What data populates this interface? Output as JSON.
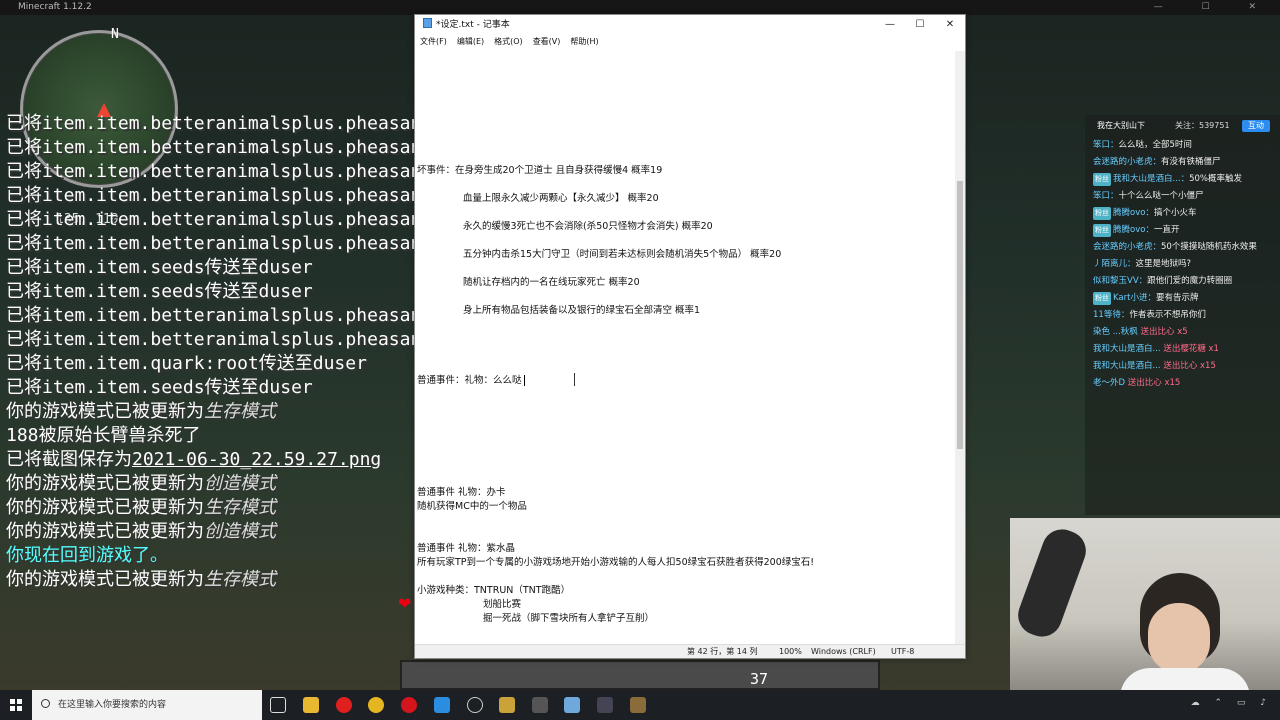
{
  "minecraft": {
    "window_title": "Minecraft 1.12.2",
    "minimap": {
      "compass_n": "N",
      "coords_text": "135, 119"
    },
    "chat_lines": [
      {
        "text": "已将item.item.betteranimalsplus.pheasant_"
      },
      {
        "text": "已将item.item.betteranimalsplus.pheasant_"
      },
      {
        "text": "已将item.item.betteranimalsplus.pheasant_"
      },
      {
        "text": "已将item.item.betteranimalsplus.pheasant_"
      },
      {
        "text": "已将item.item.betteranimalsplus.pheasant_"
      },
      {
        "text": "已将item.item.betteranimalsplus.pheasant_"
      },
      {
        "text": "已将item.item.seeds传送至duser"
      },
      {
        "text": "已将item.item.seeds传送至duser"
      },
      {
        "text": "已将item.item.betteranimalsplus.pheasant_"
      },
      {
        "text": "已将item.item.betteranimalsplus.pheasant_"
      },
      {
        "text": "已将item.item.quark:root传送至duser"
      },
      {
        "text": "已将item.item.seeds传送至duser"
      }
    ],
    "mode_lines": [
      {
        "prefix": "你的游戏模式已被更新为",
        "mode": "生存模式"
      },
      {
        "plain": "188被原始长臂兽杀死了"
      },
      {
        "prefix": "已将截图保存为",
        "link": "2021-06-30_22.59.27.png"
      },
      {
        "prefix": "你的游戏模式已被更新为",
        "mode": "创造模式"
      },
      {
        "prefix": "你的游戏模式已被更新为",
        "mode": "生存模式"
      },
      {
        "prefix": "你的游戏模式已被更新为",
        "mode": "创造模式"
      },
      {
        "cyan": "你现在回到游戏了。"
      },
      {
        "prefix": "你的游戏模式已被更新为",
        "mode": "生存模式"
      }
    ],
    "hotbar_count": "37"
  },
  "notepad": {
    "title": "*设定.txt - 记事本",
    "controls": {
      "min": "—",
      "max": "☐",
      "close": "✕"
    },
    "menu": [
      "文件(F)",
      "编辑(E)",
      "格式(O)",
      "查看(V)",
      "帮助(H)"
    ],
    "lines": [
      "坏事件：在身旁生成20个卫道士  且自身获得缓慢4      概率19",
      "血量上限永久减少两颗心【永久减少】      概率20",
      "永久的缓慢3死亡也不会消除(杀50只怪物才会消失)      概率20",
      "五分钟内击杀15大门守卫（时间到若未达标则会随机消失5个物品）     概率20",
      "随机让存档内的一名在线玩家死亡      概率20",
      "身上所有物品包括装备以及银行的绿宝石全部清空        概率1",
      "普通事件：礼物：么么哒",
      "普通事件  礼物：办卡",
      "随机获得MC中的一个物品",
      "普通事件  礼物：紫水晶",
      "所有玩家TP到一个专属的小游戏场地开始小游戏输的人每人扣50绿宝石获胜者获得200绿宝石!",
      "小游戏种类：TNTRUN（TNT跑酷）",
      "划船比赛",
      "掘一死战（脚下雪块所有人拿铲子互削）"
    ],
    "status": {
      "position": "第 42 行，第 14 列",
      "zoom": "100%",
      "eol": "Windows (CRLF)",
      "encoding": "UTF-8"
    }
  },
  "stream": {
    "room": "我在大别山下",
    "follow": "关注：539751",
    "interact_btn": "互动",
    "messages": [
      {
        "user": "笨口：",
        "text": "么么哒，全部5时间"
      },
      {
        "user": "会迷路的小老虎：",
        "text": "有没有铁桶僵尸"
      },
      {
        "badge": "粉丝",
        "user": "我和大山是酒白...：",
        "text": "50%概率触发"
      },
      {
        "user": "笨口：",
        "text": "十个么么哒一个小僵尸"
      },
      {
        "badge": "粉丝",
        "user": "腾腾ovo：",
        "text": "搞个小火车"
      },
      {
        "badge": "粉丝",
        "user": "腾腾ovo：",
        "text": "一直开"
      },
      {
        "user": "会迷路的小老虎：",
        "text": "50个摸摸哒随机药水效果"
      },
      {
        "user": "丿陌离儿：",
        "text": "这里是地狱吗?"
      },
      {
        "user": "似和黎玉VV：",
        "text": "跟他们爱的魔力转圈圈"
      },
      {
        "badge": "粉丝",
        "user": "Kart小进：",
        "text": "要有告示牌"
      },
      {
        "user": "11等待：",
        "text": "作者表示不想吊你们"
      },
      {
        "user": "染色 ...秋枫",
        "gift": "送出比心 x5"
      },
      {
        "user": "我和大山是酒白...",
        "gift": "送出樱花糖 x1"
      },
      {
        "user": "我和大山是酒白...",
        "gift": "送出比心 x15"
      },
      {
        "user": "老～外D",
        "gift": "送出比心 x15"
      }
    ]
  },
  "taskbar": {
    "search_placeholder": "在这里输入你要搜索的内容"
  }
}
